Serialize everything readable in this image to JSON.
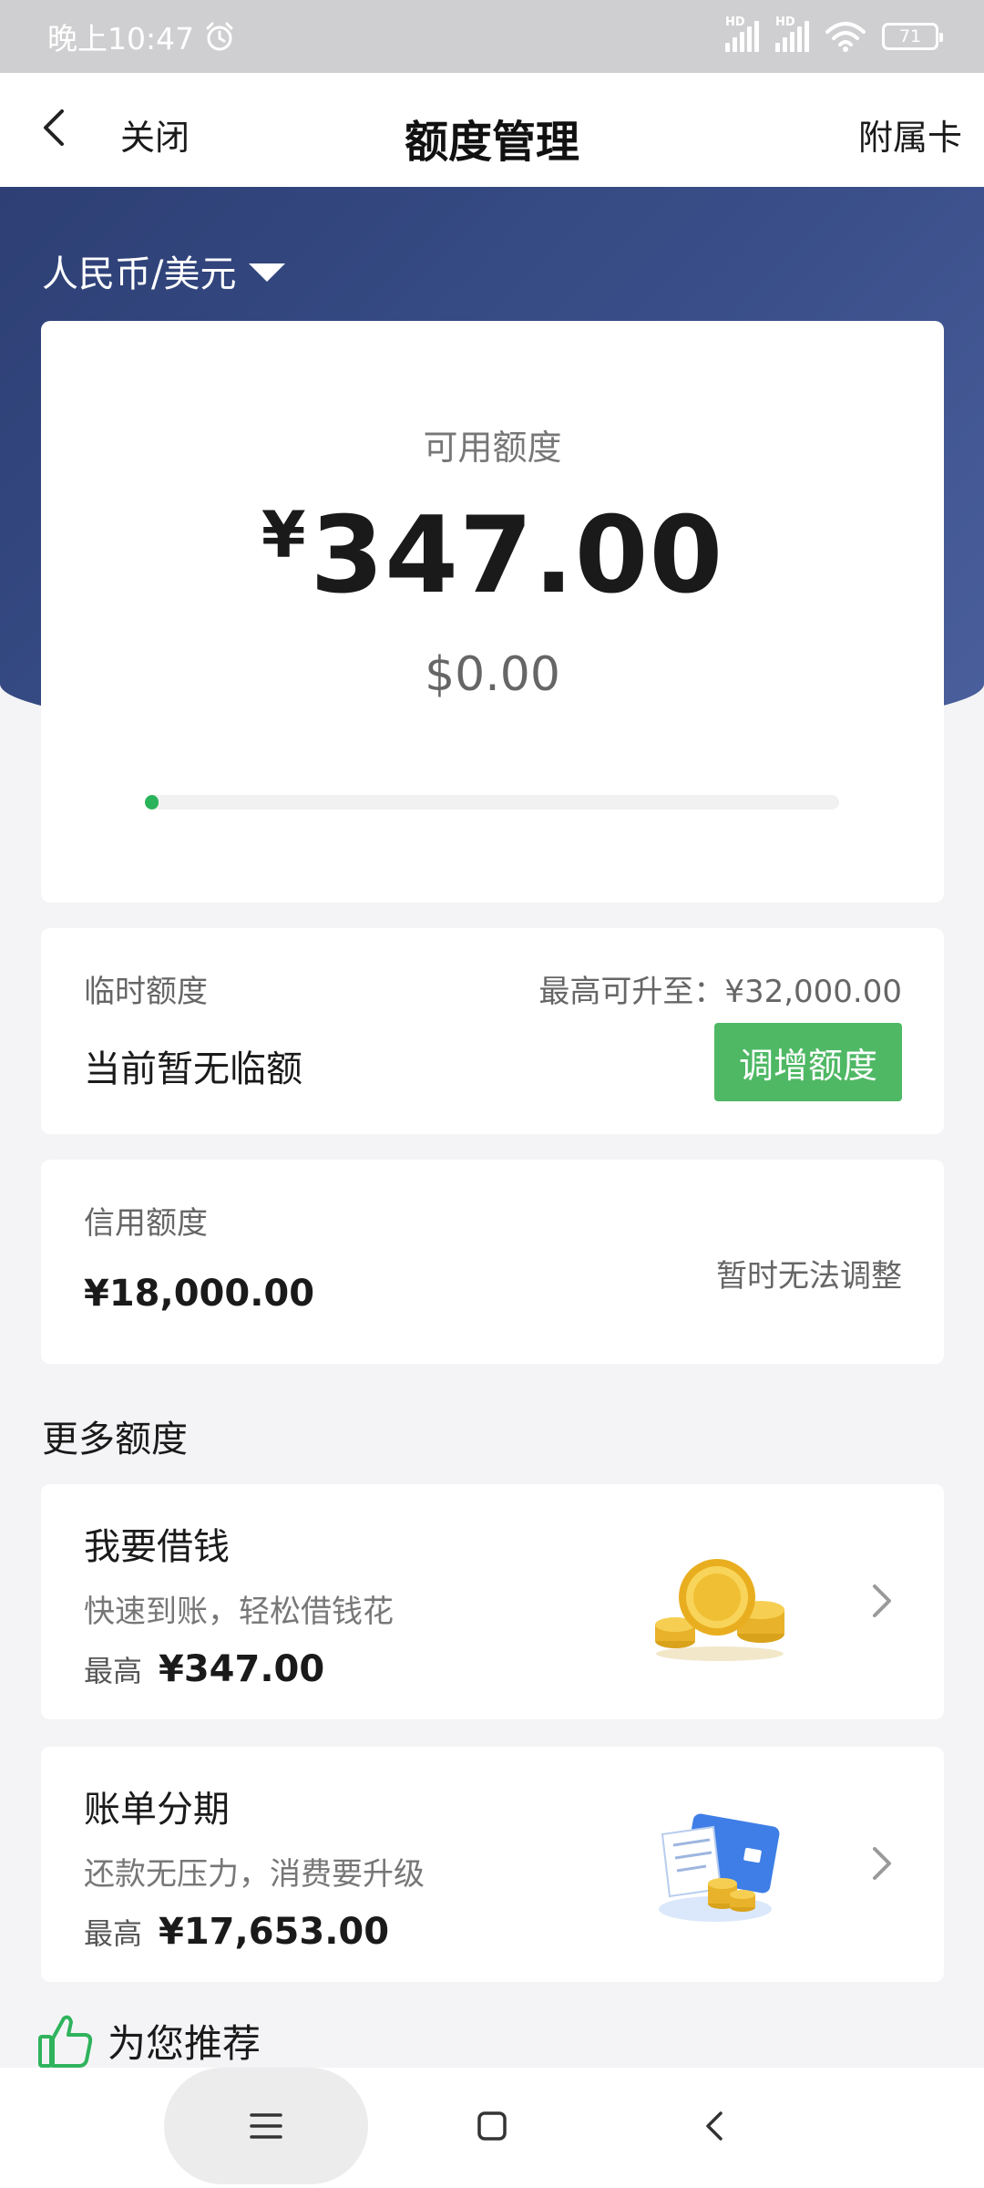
{
  "status_bar": {
    "time": "晚上10:47",
    "signal1_label": "HD",
    "signal2_label": "HD",
    "battery": "71"
  },
  "nav": {
    "close_label": "关闭",
    "title": "额度管理",
    "right_label": "附属卡"
  },
  "currency_selector": "人民币/美元",
  "available": {
    "label": "可用额度",
    "currency_symbol": "¥",
    "amount": "347.00",
    "usd_amount": "$0.00",
    "progress_fraction": 0.02
  },
  "temp_credit": {
    "label": "临时额度",
    "max_text": "最高可升至：¥32,000.00",
    "current_text": "当前暂无临额",
    "button_label": "调增额度"
  },
  "credit_limit": {
    "label": "信用额度",
    "amount": "¥18,000.00",
    "note": "暂时无法调整"
  },
  "more_section_title": "更多额度",
  "offers": [
    {
      "title": "我要借钱",
      "subtitle": "快速到账，轻松借钱花",
      "max_label": "最高",
      "max_value": "¥347.00",
      "icon": "gold-coins-icon"
    },
    {
      "title": "账单分期",
      "subtitle": "还款无压力，消费要升级",
      "max_label": "最高",
      "max_value": "¥17,653.00",
      "icon": "bill-installment-icon"
    }
  ],
  "recommend_label": "为您推荐",
  "colors": {
    "hero_blue": "#2d3f74",
    "accent_green": "#4fb865",
    "progress_green": "#29b35a"
  }
}
